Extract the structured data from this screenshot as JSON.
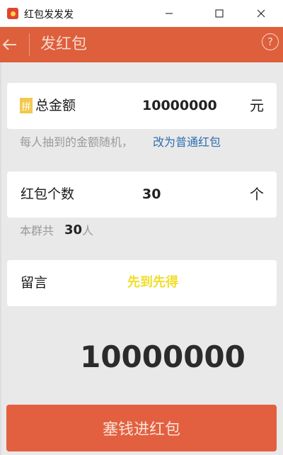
{
  "window": {
    "title": "红包发发发",
    "minimize_label": "minimize",
    "maximize_label": "maximize",
    "close_label": "close"
  },
  "appbar": {
    "back_icon": "arrow-left-icon",
    "title": "发红包",
    "help_icon": "question-circle-icon",
    "help_glyph": "?"
  },
  "amount_card": {
    "badge": "拼",
    "label": "总金额",
    "value": "10000000",
    "unit": "元"
  },
  "amount_hint": {
    "text": "每人抽到的金额随机，",
    "link": "改为普通红包"
  },
  "count_card": {
    "label": "红包个数",
    "value": "30",
    "unit": "个"
  },
  "group_info": {
    "prefix": "本群共",
    "count": "30",
    "suffix": "人"
  },
  "message_card": {
    "label": "留言",
    "value": "先到先得"
  },
  "total": "10000000",
  "submit_button": "塞钱进红包",
  "colors": {
    "brand": "#dd5f3c",
    "button": "#e2603f",
    "badge": "#f3c94d",
    "message_text": "#f0de2a",
    "link": "#2f6fb0"
  }
}
